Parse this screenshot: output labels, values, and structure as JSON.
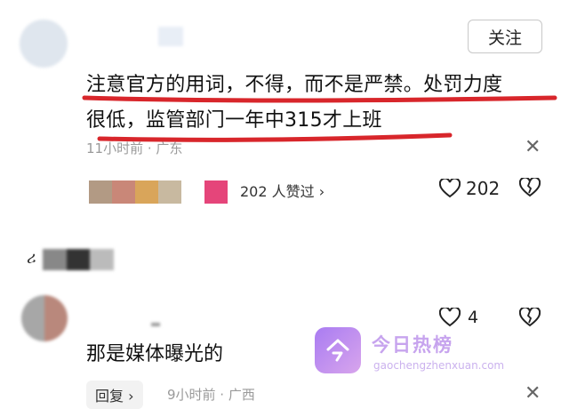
{
  "comment1": {
    "follow_label": "关注",
    "text_line1": "注意官方的用词，不得，而不是严禁。处罚力度",
    "text_line2": "很低，监管部门一年中315才上班",
    "meta": "11小时前 · 广东",
    "likers_count_label": "202 人赞过 ›",
    "like_count": "202"
  },
  "comment2": {
    "username_fragment": "ሪ",
    "like_count": "4",
    "text": "那是媒体曝光的",
    "reply_label": "回复",
    "chevron": "›",
    "meta": "9小时前 · 广西"
  },
  "watermark": {
    "title": "今日热榜",
    "subtitle": "gaochengzhenxuan.com"
  },
  "colors": {
    "underline": "#d8262b",
    "liker_colors": [
      "#b29a84",
      "#c98778",
      "#d9a55a",
      "#c8b9a0",
      "#e5457a"
    ],
    "watermark_purple": "#b38af0"
  }
}
